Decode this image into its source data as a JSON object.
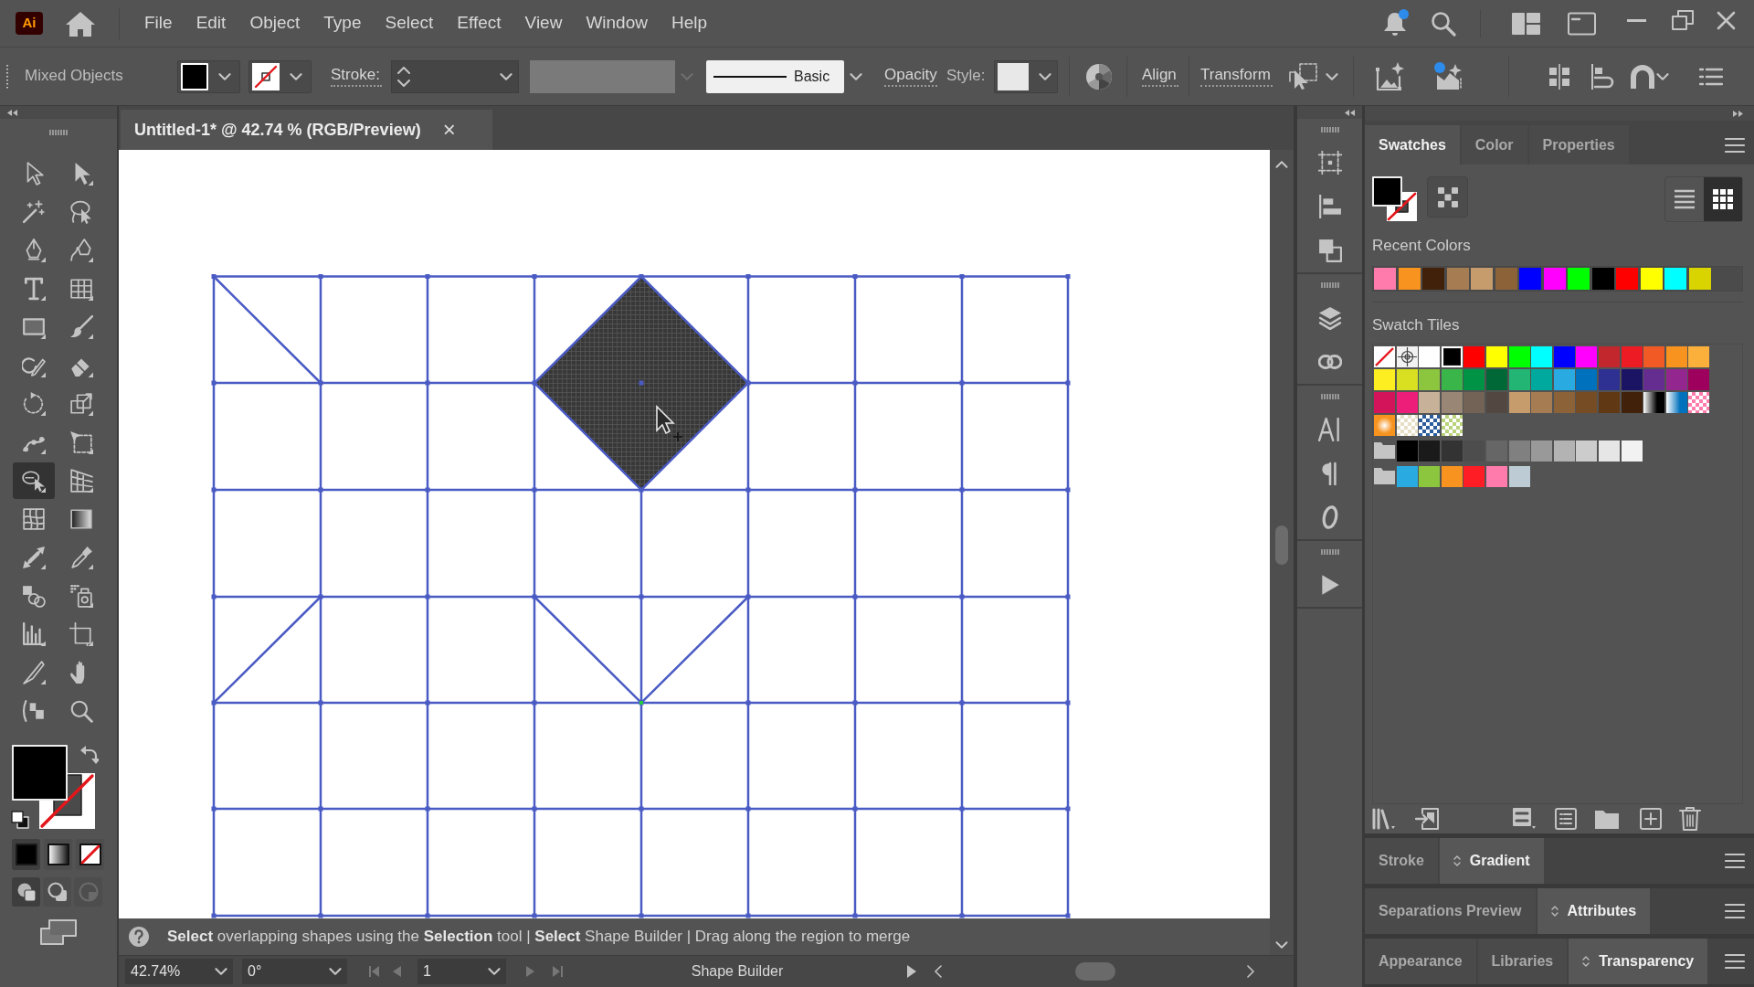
{
  "menu_bar": {
    "logo": "Ai",
    "items": [
      "File",
      "Edit",
      "Object",
      "Type",
      "Select",
      "Effect",
      "View",
      "Window",
      "Help"
    ],
    "notifications_unread": true
  },
  "control_bar": {
    "selection_label": "Mixed Objects",
    "stroke_label": "Stroke:",
    "brush": "Basic",
    "opacity_label": "Opacity",
    "style_label": "Style:",
    "align_label": "Align",
    "transform_label": "Transform"
  },
  "document_tab": {
    "title": "Untitled-1* @ 42.74 % (RGB/Preview)",
    "close": "×"
  },
  "tools": [
    {
      "kind": "selection",
      "selected": false
    },
    {
      "kind": "direct-selection",
      "selected": false
    },
    {
      "kind": "magic-wand",
      "selected": false
    },
    {
      "kind": "lasso",
      "selected": false
    },
    {
      "kind": "pen",
      "selected": false
    },
    {
      "kind": "curvature",
      "selected": false
    },
    {
      "kind": "type",
      "selected": false
    },
    {
      "kind": "grid",
      "selected": false
    },
    {
      "kind": "rectangle",
      "selected": false
    },
    {
      "kind": "brush",
      "selected": false
    },
    {
      "kind": "shaper",
      "selected": false
    },
    {
      "kind": "eraser",
      "selected": false
    },
    {
      "kind": "rotate",
      "selected": false
    },
    {
      "kind": "scale",
      "selected": false
    },
    {
      "kind": "warp",
      "selected": false
    },
    {
      "kind": "free-transform",
      "selected": false
    },
    {
      "kind": "shape-builder",
      "selected": true
    },
    {
      "kind": "perspective",
      "selected": false
    },
    {
      "kind": "mesh",
      "selected": false
    },
    {
      "kind": "gradient",
      "selected": false
    },
    {
      "kind": "width",
      "selected": false
    },
    {
      "kind": "eyedropper",
      "selected": false
    },
    {
      "kind": "blend",
      "selected": false
    },
    {
      "kind": "sprayer",
      "selected": false
    },
    {
      "kind": "graph",
      "selected": false
    },
    {
      "kind": "artboard",
      "selected": false
    },
    {
      "kind": "slice",
      "selected": false
    },
    {
      "kind": "hand",
      "selected": false
    },
    {
      "kind": "edit-toolbar",
      "selected": false
    },
    {
      "kind": "zoom",
      "selected": false
    }
  ],
  "color_modes": [
    {
      "kind": "color",
      "selected": true
    },
    {
      "kind": "gradient",
      "selected": false
    },
    {
      "kind": "none",
      "selected": false
    }
  ],
  "draw_modes": [
    {
      "kind": "normal",
      "selected": true,
      "disabled": false
    },
    {
      "kind": "behind",
      "selected": false,
      "disabled": false
    },
    {
      "kind": "inside",
      "selected": false,
      "disabled": true
    }
  ],
  "status_hint": "**Select** overlapping shapes using the **Selection** tool | **Select** Shape Builder | Drag along the region to merge",
  "bottom_bar": {
    "zoom": "42.74%",
    "rotation": "0°",
    "artboard": "1",
    "current_tool": "Shape Builder"
  },
  "swatches_panel": {
    "tabs": [
      {
        "label": "Swatches",
        "selected": true
      },
      {
        "label": "Color",
        "selected": false
      },
      {
        "label": "Properties",
        "selected": false
      }
    ],
    "view_buttons": [
      {
        "kind": "list",
        "selected": false
      },
      {
        "kind": "grid",
        "selected": true
      }
    ],
    "recent_colors_label": "Recent Colors",
    "recent_colors": [
      {
        "color": "#ff7bac"
      },
      {
        "color": "#f7931e"
      },
      {
        "color": "#42210b"
      },
      {
        "color": "#a67c52"
      },
      {
        "color": "#c69c6d"
      },
      {
        "color": "#8c6239"
      },
      {
        "color": "#0000ff"
      },
      {
        "color": "#ff00ff"
      },
      {
        "color": "#00ff00"
      },
      {
        "color": "#000000"
      },
      {
        "color": "#ff0000"
      },
      {
        "color": "#ffff00"
      },
      {
        "color": "#00ffff"
      },
      {
        "color": "#d9d400"
      }
    ],
    "swatch_tiles_label": "Swatch Tiles",
    "swatch_rows": [
      [
        {
          "kind": "none",
          "selected": false
        },
        {
          "kind": "registration",
          "selected": false
        },
        {
          "kind": "color",
          "color": "#ffffff",
          "selected": false
        },
        {
          "kind": "color",
          "color": "#000000",
          "selected": true
        },
        {
          "kind": "color",
          "color": "#ff0000",
          "selected": false
        },
        {
          "kind": "color",
          "color": "#ffff00",
          "selected": false
        },
        {
          "kind": "color",
          "color": "#00ff00",
          "selected": false
        },
        {
          "kind": "color",
          "color": "#00ffff",
          "selected": false
        },
        {
          "kind": "color",
          "color": "#0000ff",
          "selected": false
        },
        {
          "kind": "color",
          "color": "#ff00ff",
          "selected": false
        },
        {
          "kind": "color",
          "color": "#c1272d",
          "selected": false
        },
        {
          "kind": "color",
          "color": "#ed1c24",
          "selected": false
        },
        {
          "kind": "color",
          "color": "#f15a24",
          "selected": false
        },
        {
          "kind": "color",
          "color": "#f7931e",
          "selected": false
        },
        {
          "kind": "color",
          "color": "#fbb03b",
          "selected": false
        }
      ],
      [
        {
          "kind": "color",
          "color": "#fcee21",
          "selected": false
        },
        {
          "kind": "color",
          "color": "#d9e021",
          "selected": false
        },
        {
          "kind": "color",
          "color": "#8cc63f",
          "selected": false
        },
        {
          "kind": "color",
          "color": "#39b54a",
          "selected": false
        },
        {
          "kind": "color",
          "color": "#009245",
          "selected": false
        },
        {
          "kind": "color",
          "color": "#006837",
          "selected": false
        },
        {
          "kind": "color",
          "color": "#22b573",
          "selected": false
        },
        {
          "kind": "color",
          "color": "#00a99d",
          "selected": false
        },
        {
          "kind": "color",
          "color": "#29abe2",
          "selected": false
        },
        {
          "kind": "color",
          "color": "#0071bc",
          "selected": false
        },
        {
          "kind": "color",
          "color": "#2e3192",
          "selected": false
        },
        {
          "kind": "color",
          "color": "#1b1464",
          "selected": false
        },
        {
          "kind": "color",
          "color": "#662d91",
          "selected": false
        },
        {
          "kind": "color",
          "color": "#93278f",
          "selected": false
        },
        {
          "kind": "color",
          "color": "#9e005d",
          "selected": false
        }
      ],
      [
        {
          "kind": "color",
          "color": "#d4145a",
          "selected": false
        },
        {
          "kind": "color",
          "color": "#ed1e79",
          "selected": false
        },
        {
          "kind": "color",
          "color": "#c7b299",
          "selected": false
        },
        {
          "kind": "color",
          "color": "#998675",
          "selected": false
        },
        {
          "kind": "color",
          "color": "#736357",
          "selected": false
        },
        {
          "kind": "color",
          "color": "#534741",
          "selected": false
        },
        {
          "kind": "color",
          "color": "#c69c6d",
          "selected": false
        },
        {
          "kind": "color",
          "color": "#a67c52",
          "selected": false
        },
        {
          "kind": "color",
          "color": "#8c6239",
          "selected": false
        },
        {
          "kind": "color",
          "color": "#754c24",
          "selected": false
        },
        {
          "kind": "color",
          "color": "#603813",
          "selected": false
        },
        {
          "kind": "color",
          "color": "#42210b",
          "selected": false
        },
        {
          "kind": "gradient",
          "color": "#000000",
          "selected": false
        },
        {
          "kind": "gradient",
          "color": "#0071bc",
          "selected": false
        },
        {
          "kind": "pattern",
          "color": "#ff7bac",
          "selected": false
        }
      ],
      [
        {
          "kind": "radial",
          "color": "#f7931e",
          "selected": false
        },
        {
          "kind": "pattern",
          "color": "#e6dfc6",
          "selected": false
        },
        {
          "kind": "pattern",
          "color": "#2b5c9e",
          "selected": false
        },
        {
          "kind": "pattern",
          "color": "#b9d27c",
          "selected": false
        }
      ]
    ],
    "color_groups": [
      {
        "swatches": [
          {
            "color": "#000000",
            "selected": false
          },
          {
            "color": "#1a1a1a",
            "selected": false
          },
          {
            "color": "#333333",
            "selected": false
          },
          {
            "color": "#4d4d4d",
            "selected": false
          },
          {
            "color": "#666666",
            "selected": false
          },
          {
            "color": "#808080",
            "selected": false
          },
          {
            "color": "#999999",
            "selected": false
          },
          {
            "color": "#b3b3b3",
            "selected": false
          },
          {
            "color": "#cccccc",
            "selected": false
          },
          {
            "color": "#e6e6e6",
            "selected": false
          },
          {
            "color": "#f2f2f2",
            "selected": false
          }
        ]
      },
      {
        "swatches": [
          {
            "color": "#29abe2",
            "selected": false
          },
          {
            "color": "#8cc63f",
            "selected": false
          },
          {
            "color": "#f7931e",
            "selected": false
          },
          {
            "color": "#ff1d25",
            "selected": false
          },
          {
            "color": "#ff7bac",
            "selected": false
          },
          {
            "color": "#bdccd4",
            "selected": false
          }
        ]
      }
    ]
  },
  "panel_groups": [
    {
      "tabs": [
        {
          "label": "Stroke",
          "selected": false
        },
        {
          "label": "Gradient",
          "selected": true
        }
      ]
    },
    {
      "tabs": [
        {
          "label": "Separations Preview",
          "selected": false
        },
        {
          "label": "Attributes",
          "selected": true
        }
      ]
    },
    {
      "tabs": [
        {
          "label": "Appearance",
          "selected": false
        },
        {
          "label": "Libraries",
          "selected": false
        },
        {
          "label": "Transparency",
          "selected": true
        }
      ]
    }
  ]
}
